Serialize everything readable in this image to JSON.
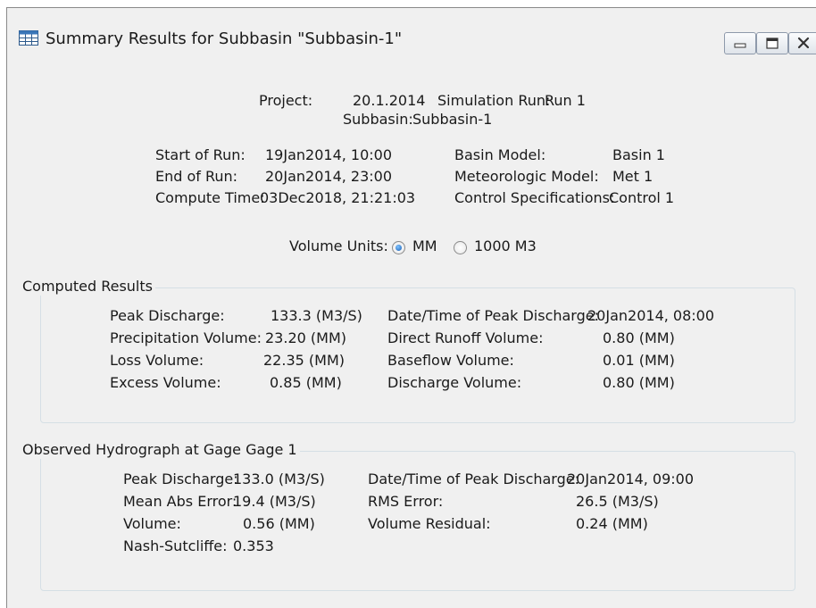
{
  "window": {
    "title": "Summary Results for Subbasin \"Subbasin-1\""
  },
  "header": {
    "project_label": "Project:",
    "project_value": "20.1.2014",
    "sim_label": "Simulation Run:",
    "sim_value": "Run 1",
    "subbasin_label": "Subbasin:",
    "subbasin_value": "Subbasin-1"
  },
  "run_info": {
    "start_label": "Start of Run:",
    "start_value": "19Jan2014, 10:00",
    "end_label": "End of Run:",
    "end_value": "20Jan2014, 23:00",
    "compute_label": "Compute Time:",
    "compute_value": "03Dec2018, 21:21:03",
    "basin_label": "Basin Model:",
    "basin_value": "Basin 1",
    "met_label": "Meteorologic Model:",
    "met_value": "Met 1",
    "control_label": "Control Specifications:",
    "control_value": "Control 1"
  },
  "volume_units": {
    "label": "Volume Units:",
    "option1": "MM",
    "option2": "1000 M3",
    "selected": "MM"
  },
  "computed": {
    "title": "Computed Results",
    "peak_label": "Peak Discharge:",
    "peak_value": "133.3 (M3/S)",
    "precip_label": "Precipitation Volume:",
    "precip_value": "23.20 (MM)",
    "loss_label": "Loss Volume:",
    "loss_value": "22.35 (MM)",
    "excess_label": "Excess Volume:",
    "excess_value": "0.85 (MM)",
    "peak_dt_label": "Date/Time of Peak Discharge:",
    "peak_dt_value": "20Jan2014, 08:00",
    "direct_label": "Direct Runoff Volume:",
    "direct_value": "0.80 (MM)",
    "baseflow_label": "Baseflow Volume:",
    "baseflow_value": "0.01 (MM)",
    "discharge_label": "Discharge Volume:",
    "discharge_value": "0.80 (MM)"
  },
  "observed": {
    "title": "Observed Hydrograph at Gage Gage 1",
    "peak_label": "Peak Discharge:",
    "peak_value": "133.0 (M3/S)",
    "mae_label": "Mean Abs Error:",
    "mae_value": "19.4 (M3/S)",
    "volume_label": "Volume:",
    "volume_value": "0.56 (MM)",
    "nash_label": "Nash-Sutcliffe:",
    "nash_value": "0.353",
    "peak_dt_label": "Date/Time of Peak Discharge:",
    "peak_dt_value": "20Jan2014, 09:00",
    "rms_label": "RMS Error:",
    "rms_value": "26.5 (M3/S)",
    "resid_label": "Volume Residual:",
    "resid_value": "0.24 (MM)"
  }
}
